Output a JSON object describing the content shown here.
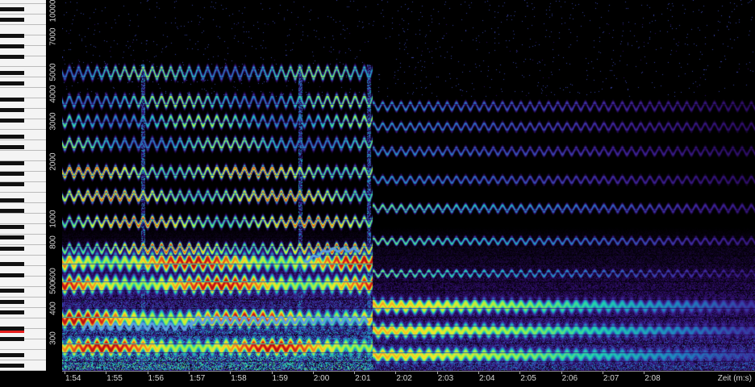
{
  "frequency_axis": {
    "labels": [
      "1000",
      "7000",
      "5000",
      "4000",
      "3000",
      "2000",
      "1000",
      "800",
      "600",
      "500",
      "400",
      "300"
    ],
    "display_labels": [
      "10000",
      "7000",
      "5000",
      "4000",
      "3000",
      "2000",
      "1000",
      "800",
      "1000",
      "600",
      "500",
      "400",
      "300"
    ]
  },
  "time_axis": {
    "labels": [
      "1:54",
      "1:55",
      "1:56",
      "1:57",
      "1:58",
      "1:59",
      "2:00",
      "2:01",
      "2:02",
      "2:03",
      "2:04",
      "2:05",
      "2:06",
      "2:07",
      "2:08"
    ],
    "unit_label": "Zeit (m:s)"
  },
  "colors": {
    "background": "#000000",
    "active_key": "#e8201e",
    "pitch_trace": "#5aa0e0",
    "colormap": [
      "#000000",
      "#2a0a5e",
      "#3b2a9a",
      "#1f7fbf",
      "#1fd0b0",
      "#9bf04a",
      "#f4e52a",
      "#f08020",
      "#d41818",
      "#8a0a0a"
    ]
  }
}
